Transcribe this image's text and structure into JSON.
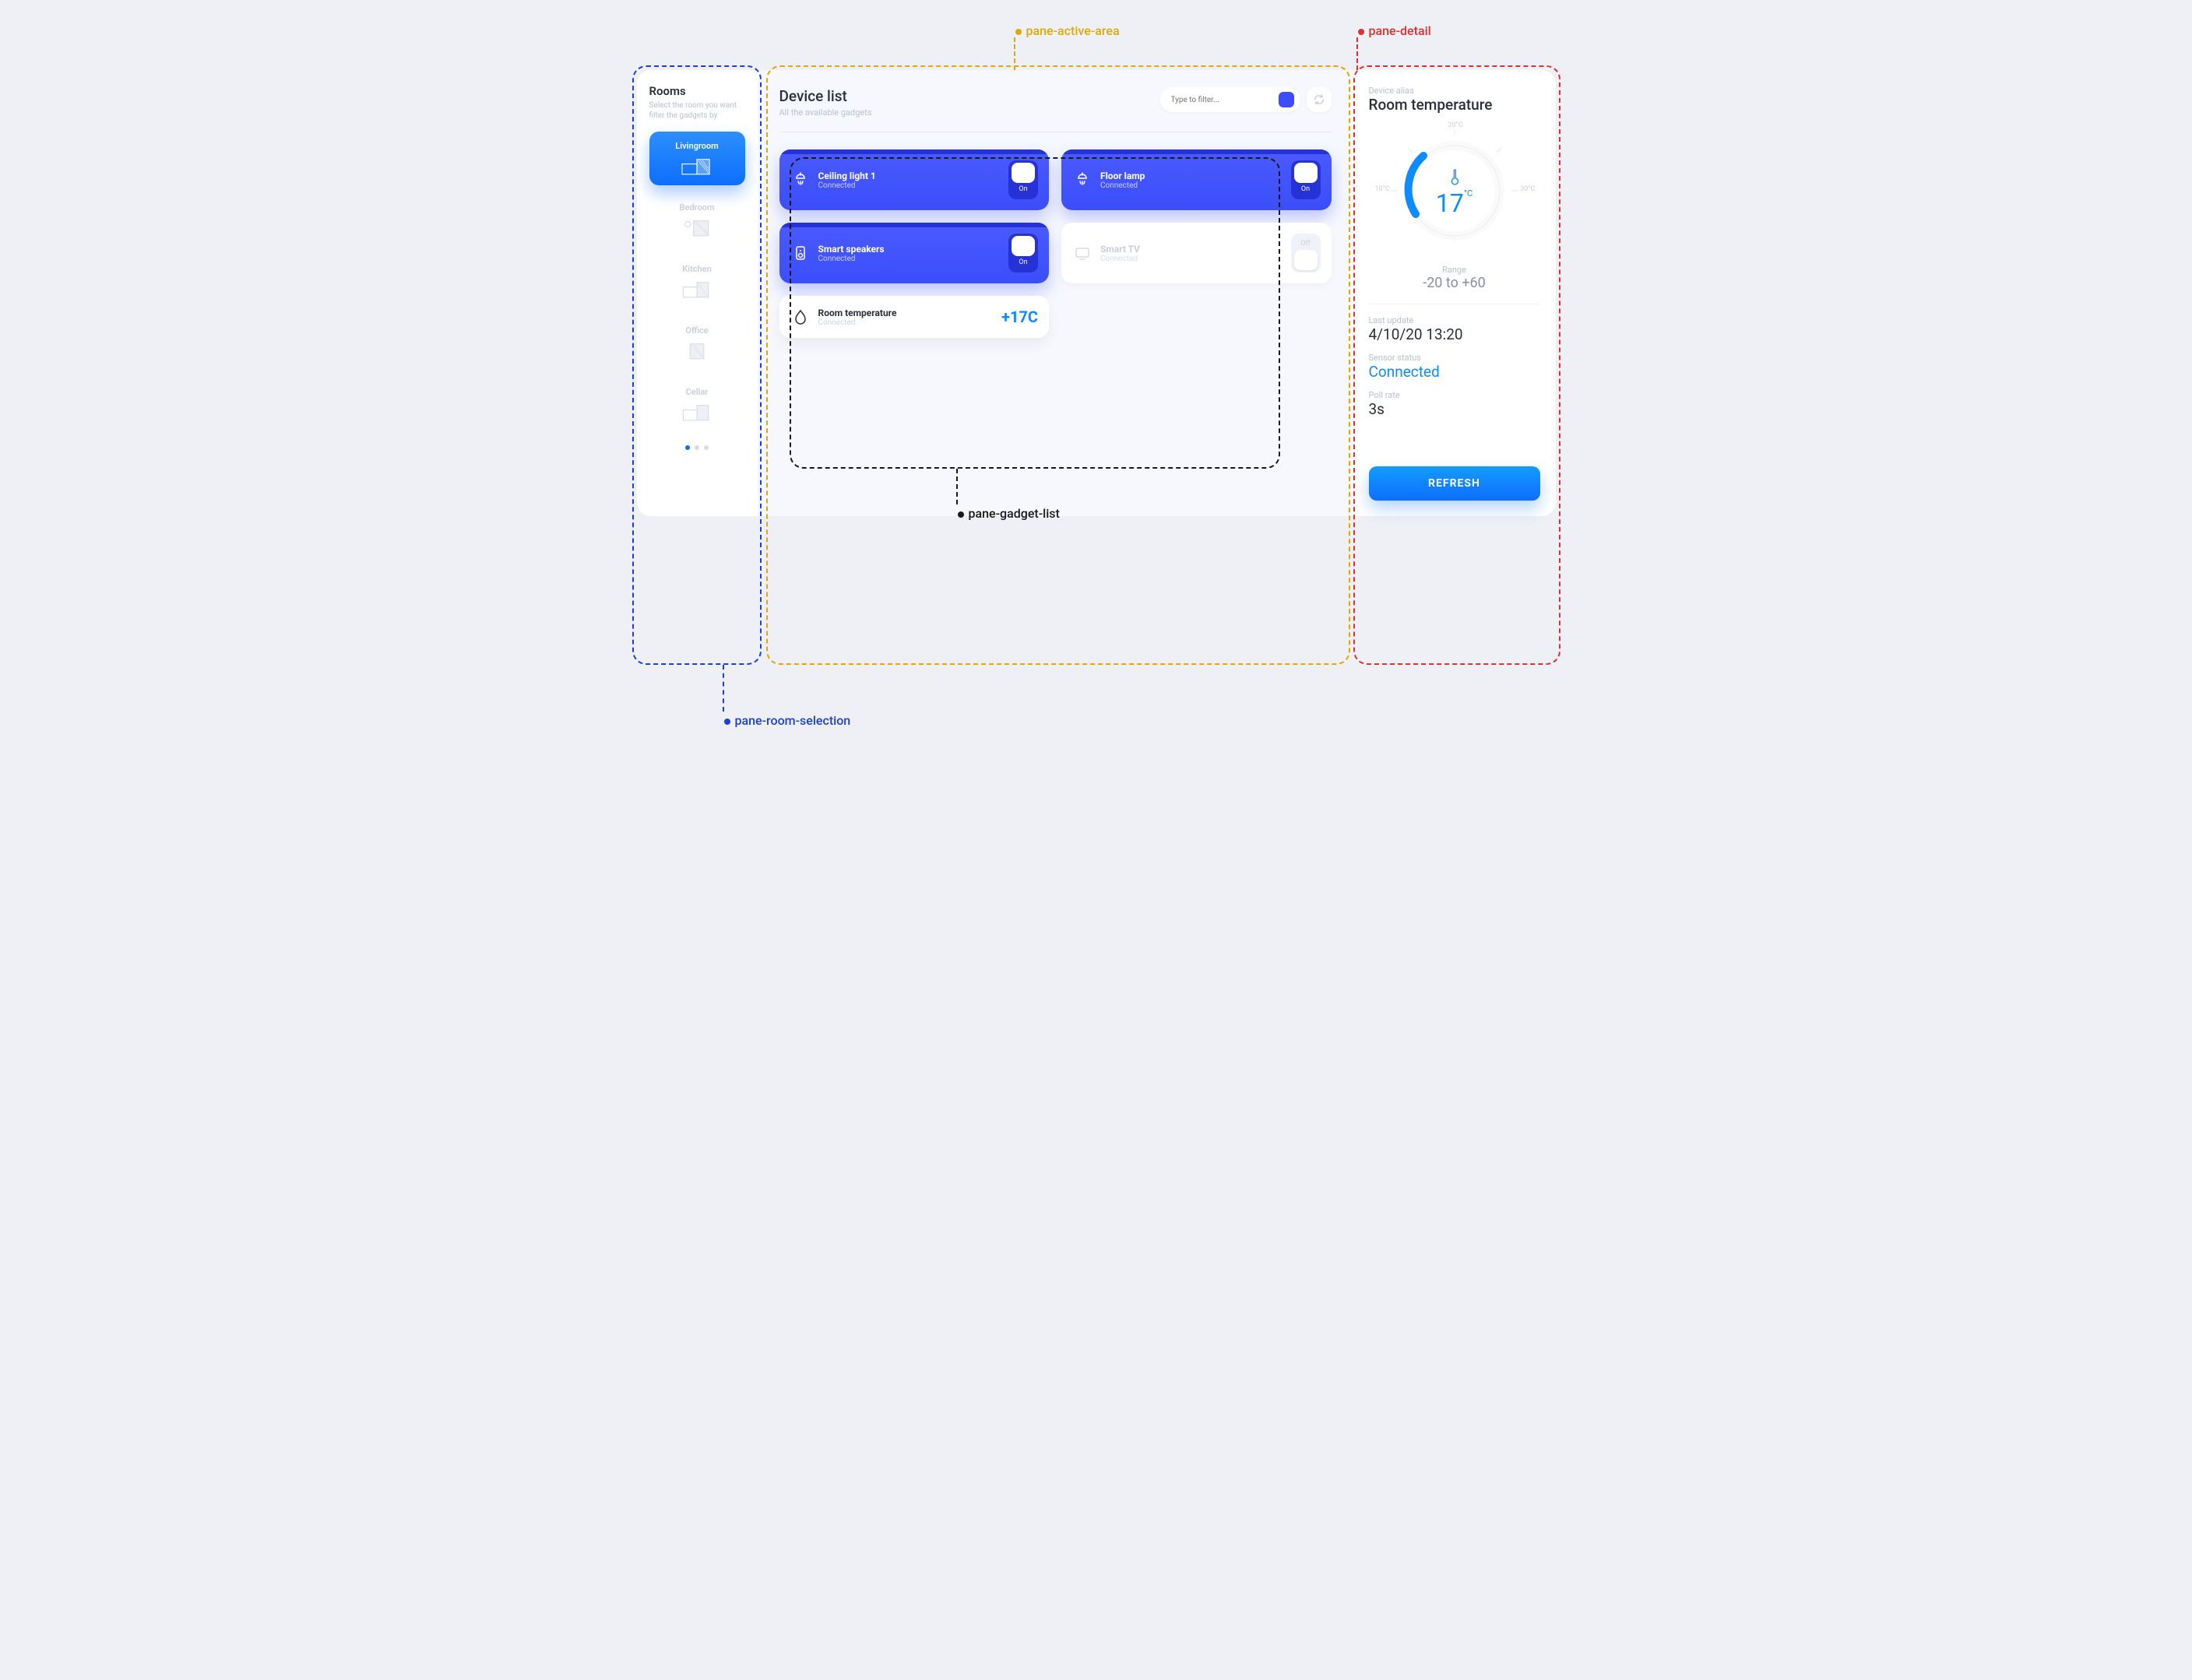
{
  "annotations": {
    "room_selection": "pane-room-selection",
    "active_area": "pane-active-area",
    "gadget_list": "pane-gadget-list",
    "detail": "pane-detail"
  },
  "sidebar": {
    "title": "Rooms",
    "subtitle": "Select the room you want filter the gadgets by",
    "rooms": [
      {
        "label": "Livingroom",
        "active": true
      },
      {
        "label": "Bedroom",
        "active": false
      },
      {
        "label": "Kitchen",
        "active": false
      },
      {
        "label": "Office",
        "active": false
      },
      {
        "label": "Cellar",
        "active": false
      }
    ]
  },
  "middle": {
    "title": "Device list",
    "subtitle": "All the available gadgets",
    "search_placeholder": "Type to filter..."
  },
  "gadgets": [
    {
      "name": "Ceiling light 1",
      "status": "Connected",
      "state": "On",
      "icon": "lamp",
      "type": "switch"
    },
    {
      "name": "Floor lamp",
      "status": "Connected",
      "state": "On",
      "icon": "lamp",
      "type": "switch"
    },
    {
      "name": "Smart speakers",
      "status": "Connected",
      "state": "On",
      "icon": "speaker",
      "type": "switch"
    },
    {
      "name": "Smart TV",
      "status": "Connected",
      "state": "Off",
      "icon": "tv",
      "type": "switch"
    },
    {
      "name": "Room temperature",
      "status": "Connected",
      "reading": "+17C",
      "icon": "drop",
      "type": "sensor"
    }
  ],
  "detail": {
    "alias_label": "Device alias",
    "alias": "Room temperature",
    "gauge": {
      "value": "17",
      "unit": "°C",
      "ticks": {
        "top": "20°C",
        "left": "10°C",
        "right": "30°C"
      }
    },
    "range_label": "Range",
    "range": "-20 to +60",
    "last_update_label": "Last update",
    "last_update": "4/10/20 13:20",
    "sensor_status_label": "Sensor status",
    "sensor_status": "Connected",
    "poll_rate_label": "Poll rate",
    "poll_rate": "3s",
    "refresh_button": "REFRESH"
  }
}
